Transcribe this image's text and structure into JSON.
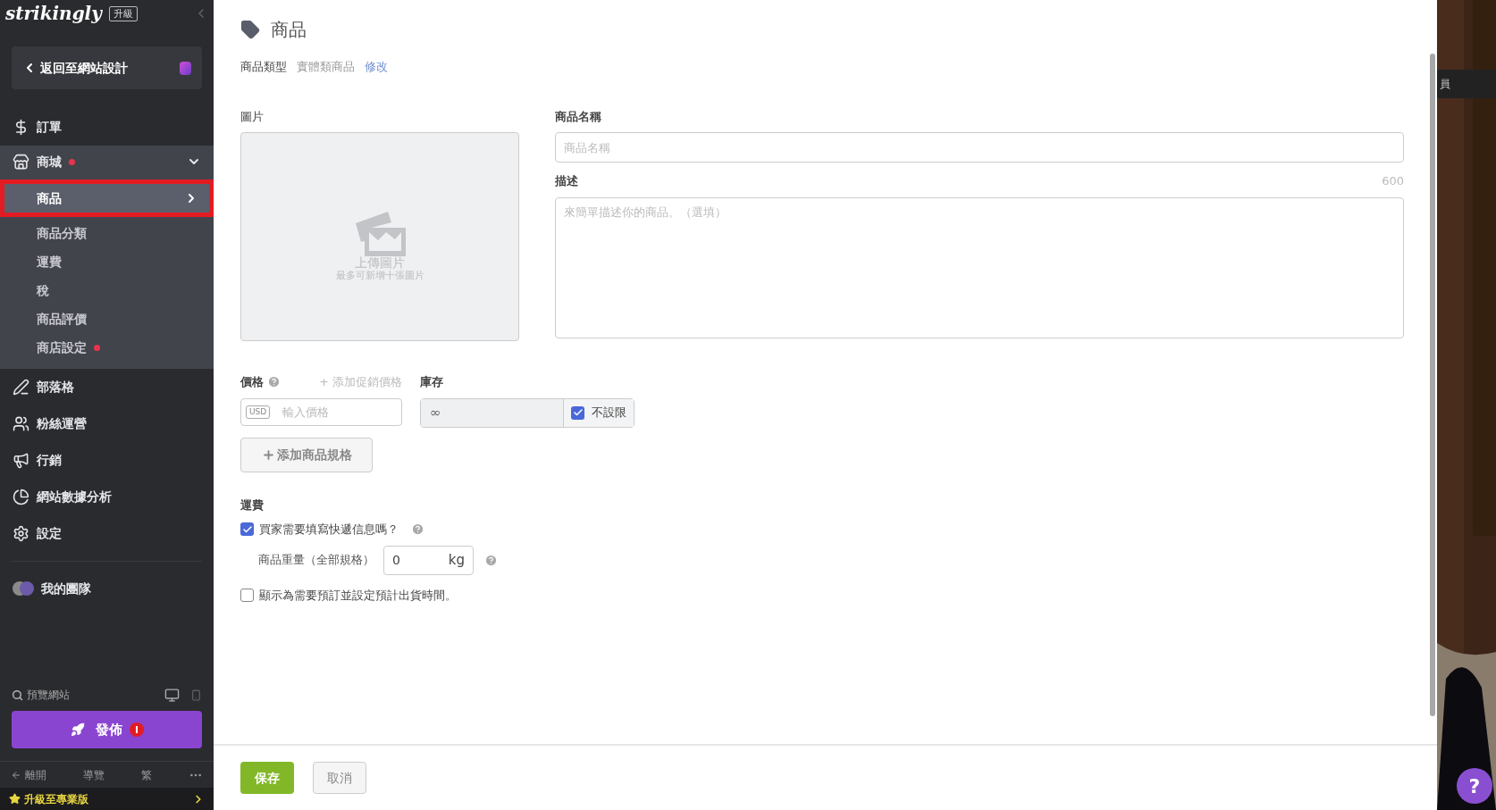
{
  "sidebar": {
    "logo": "strikingly",
    "upgrade_badge": "升級",
    "back_button": "返回至網站設計",
    "items": [
      {
        "kind": "link",
        "label": "訂單",
        "alert": false
      },
      {
        "kind": "group",
        "label": "商城",
        "alert": true,
        "expanded": true,
        "children": [
          {
            "label": "商品",
            "selected": true,
            "alert": false
          },
          {
            "label": "商品分類",
            "selected": false,
            "alert": false
          },
          {
            "label": "運費",
            "selected": false,
            "alert": false
          },
          {
            "label": "稅",
            "selected": false,
            "alert": false
          },
          {
            "label": "商品評價",
            "selected": false,
            "alert": false
          },
          {
            "label": "商店設定",
            "selected": false,
            "alert": true
          }
        ]
      },
      {
        "kind": "link",
        "label": "部落格",
        "alert": false
      },
      {
        "kind": "link",
        "label": "粉絲運營",
        "alert": false
      },
      {
        "kind": "link",
        "label": "行銷",
        "alert": false
      },
      {
        "kind": "link",
        "label": "網站數據分析",
        "alert": false
      },
      {
        "kind": "link",
        "label": "設定",
        "alert": false
      },
      {
        "kind": "team",
        "label": "我的團隊",
        "alert": false
      }
    ],
    "preview": "預覽網站",
    "publish": {
      "label": "發佈",
      "alert": true
    },
    "bottom_nav": [
      "離開",
      "導覽",
      "繁"
    ],
    "upgrade": "升級至專業版"
  },
  "page": {
    "title": "商品",
    "type_label": "商品類型",
    "type_value": "實體類商品",
    "type_link": "修改",
    "image": {
      "label": "圖片",
      "upload_text": "上傳圖片",
      "hint": "最多可新增十張圖片"
    },
    "name": {
      "label": "商品名稱",
      "placeholder": "商品名稱"
    },
    "description": {
      "label": "描述",
      "counter": "600",
      "placeholder": "來簡單描述你的商品。（選填）"
    },
    "price": {
      "label": "價格",
      "sale_link": "+ 添加促銷價格",
      "currency": "USD",
      "placeholder": "輸入價格"
    },
    "stock": {
      "label": "庫存",
      "value": "∞",
      "unlimited": {
        "label": "不設限",
        "checked": true
      }
    },
    "add_variant": "添加商品規格",
    "shipping": {
      "title": "運費",
      "need_info": {
        "label": "買家需要填寫快遞信息嗎？",
        "checked": true
      },
      "weight": {
        "label": "商品重量（全部規格）",
        "value": "0",
        "unit": "kg"
      },
      "preorder": {
        "label": "顯示為需要預訂並設定預計出貨時間。",
        "checked": false
      }
    },
    "footer": {
      "save": "保存",
      "cancel": "取消"
    }
  },
  "background": {
    "label": "員",
    "help_button": "?"
  }
}
